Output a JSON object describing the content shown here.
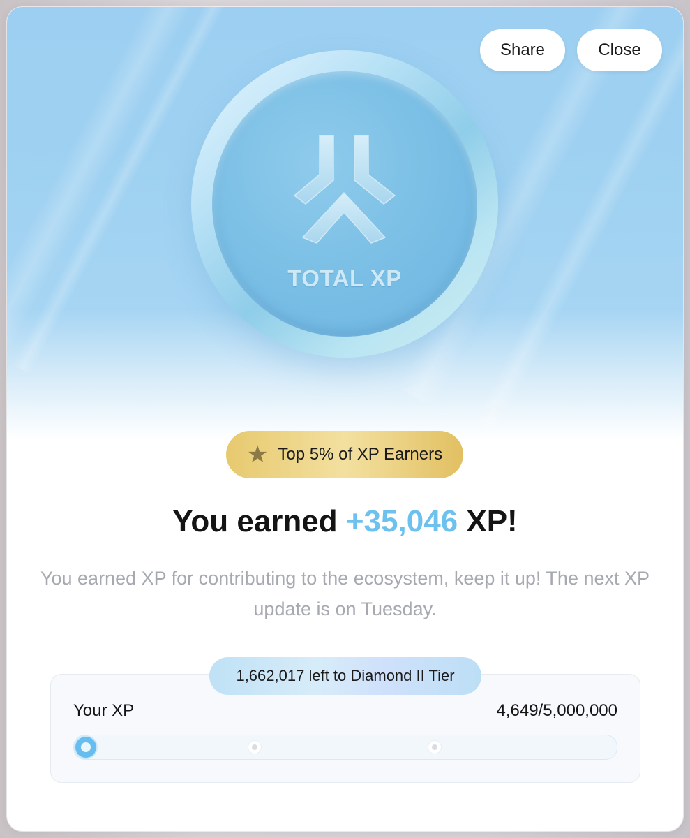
{
  "header": {
    "share_label": "Share",
    "close_label": "Close"
  },
  "coin": {
    "icon": "total-xp-logo-icon",
    "label": "TOTAL XP"
  },
  "badge": {
    "icon": "star-icon",
    "text": "Top 5% of XP Earners"
  },
  "headline": {
    "prefix": "You earned ",
    "amount": "+35,046",
    "suffix": " XP!"
  },
  "description": "You earned XP for contributing to the ecosystem, keep it up! The next XP update is on Tuesday.",
  "progress": {
    "tier_text": "1,662,017 left to Diamond II Tier",
    "label": "Your XP",
    "value_text": "4,649/5,000,000",
    "current": 4649,
    "max": 5000000,
    "milestones": 3
  },
  "colors": {
    "accent": "#6cc1ee",
    "badge_gold": "#e7c96e",
    "hero_blue": "#9ccff1",
    "muted_text": "#a6a9b0"
  }
}
